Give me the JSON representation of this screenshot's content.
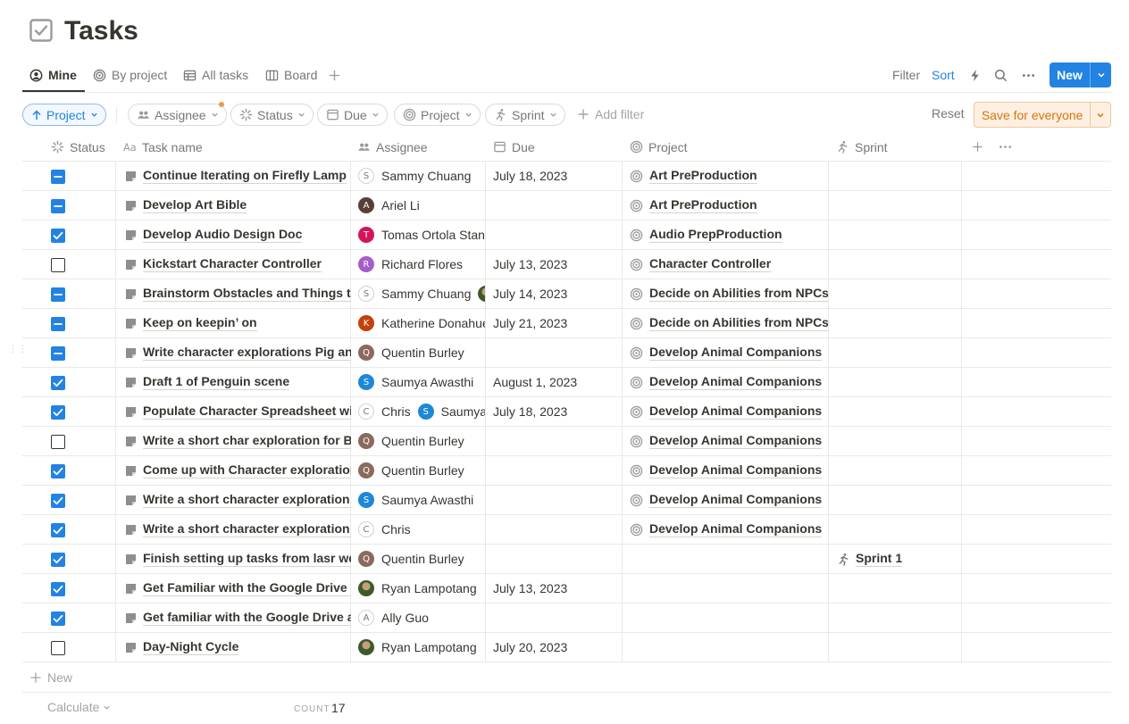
{
  "page": {
    "title": "Tasks"
  },
  "tabs": [
    {
      "label": "Mine",
      "icon": "user-circle-icon",
      "active": true
    },
    {
      "label": "By project",
      "icon": "target-icon"
    },
    {
      "label": "All tasks",
      "icon": "table-icon"
    },
    {
      "label": "Board",
      "icon": "board-icon"
    }
  ],
  "toolbar": {
    "filter": "Filter",
    "sort": "Sort",
    "new": "New"
  },
  "filters": {
    "sort_chip": "Project",
    "chips": [
      "Assignee",
      "Status",
      "Due",
      "Project",
      "Sprint"
    ],
    "add_filter": "Add filter",
    "reset": "Reset",
    "save": "Save for everyone"
  },
  "columns": {
    "status": "Status",
    "name": "Task name",
    "assignee": "Assignee",
    "due": "Due",
    "project": "Project",
    "sprint": "Sprint"
  },
  "rows": [
    {
      "status": "partial",
      "name": "Continue Iterating on Firefly Lamp",
      "assignees": [
        {
          "initial": "S",
          "name": "Sammy Chuang",
          "color": "light"
        }
      ],
      "due": "July 18, 2023",
      "project": "Art PreProduction",
      "sprint": ""
    },
    {
      "status": "partial",
      "name": "Develop Art Bible",
      "assignees": [
        {
          "initial": "A",
          "name": "Ariel Li",
          "color": "#5a3e36"
        }
      ],
      "due": "",
      "project": "Art PreProduction",
      "sprint": ""
    },
    {
      "status": "checked",
      "name": "Develop Audio Design Doc",
      "assignees": [
        {
          "initial": "T",
          "name": "Tomas Ortola Stanganelli",
          "color": "#d4145a"
        }
      ],
      "due": "",
      "project": "Audio PrepProduction",
      "sprint": ""
    },
    {
      "status": "empty",
      "name": "Kickstart Character Controller",
      "assignees": [
        {
          "initial": "R",
          "name": "Richard Flores",
          "color": "#a55ec8"
        }
      ],
      "due": "July 13, 2023",
      "project": "Character Controller",
      "sprint": ""
    },
    {
      "status": "partial",
      "name": "Brainstorm Obstacles and Things that",
      "assignees": [
        {
          "initial": "S",
          "name": "Sammy Chuang",
          "color": "light"
        },
        {
          "initial": "",
          "name": "",
          "color": "photo"
        }
      ],
      "due": "July 14, 2023",
      "project": "Decide on Abilities from NPCs",
      "sprint": ""
    },
    {
      "status": "partial",
      "name": "Keep on keepin’ on",
      "assignees": [
        {
          "initial": "K",
          "name": "Katherine Donahue",
          "color": "#c2410c"
        }
      ],
      "due": "July 21, 2023",
      "project": "Decide on Abilities from NPCs",
      "sprint": ""
    },
    {
      "status": "partial",
      "name": "Write character explorations Pig and",
      "assignees": [
        {
          "initial": "Q",
          "name": "Quentin Burley",
          "color": "#8a6a5c"
        }
      ],
      "due": "",
      "project": "Develop Animal Companions",
      "sprint": ""
    },
    {
      "status": "checked",
      "name": "Draft 1 of Penguin scene",
      "assignees": [
        {
          "initial": "S",
          "name": "Saumya Awasthi",
          "color": "#1e88d8"
        }
      ],
      "due": "August 1, 2023",
      "project": "Develop Animal Companions",
      "sprint": ""
    },
    {
      "status": "checked",
      "name": "Populate Character Spreadsheet with",
      "assignees": [
        {
          "initial": "C",
          "name": "Chris",
          "color": "light"
        },
        {
          "initial": "S",
          "name": "Saumya",
          "color": "#1e88d8"
        }
      ],
      "due": "July 18, 2023",
      "project": "Develop Animal Companions",
      "sprint": ""
    },
    {
      "status": "empty",
      "name": "Write a short char exploration for Ba",
      "assignees": [
        {
          "initial": "Q",
          "name": "Quentin Burley",
          "color": "#8a6a5c"
        }
      ],
      "due": "",
      "project": "Develop Animal Companions",
      "sprint": ""
    },
    {
      "status": "checked",
      "name": "Come up with Character exploration",
      "assignees": [
        {
          "initial": "Q",
          "name": "Quentin Burley",
          "color": "#8a6a5c"
        }
      ],
      "due": "",
      "project": "Develop Animal Companions",
      "sprint": ""
    },
    {
      "status": "checked",
      "name": "Write a short character exploration c",
      "assignees": [
        {
          "initial": "S",
          "name": "Saumya Awasthi",
          "color": "#1e88d8"
        }
      ],
      "due": "",
      "project": "Develop Animal Companions",
      "sprint": ""
    },
    {
      "status": "checked",
      "name": "Write a short character exploration c",
      "assignees": [
        {
          "initial": "C",
          "name": "Chris",
          "color": "light"
        }
      ],
      "due": "",
      "project": "Develop Animal Companions",
      "sprint": ""
    },
    {
      "status": "checked",
      "name": "Finish setting up tasks from lasr wee",
      "assignees": [
        {
          "initial": "Q",
          "name": "Quentin Burley",
          "color": "#8a6a5c"
        }
      ],
      "due": "",
      "project": "",
      "sprint": "Sprint 1"
    },
    {
      "status": "checked",
      "name": "Get Familiar with the Google Drive a",
      "assignees": [
        {
          "initial": "",
          "name": "Ryan Lampotang",
          "color": "photo"
        }
      ],
      "due": "July 13, 2023",
      "project": "",
      "sprint": ""
    },
    {
      "status": "checked",
      "name": "Get familiar with the Google Drive ar",
      "assignees": [
        {
          "initial": "A",
          "name": "Ally Guo",
          "color": "light"
        }
      ],
      "due": "",
      "project": "",
      "sprint": ""
    },
    {
      "status": "empty",
      "name": "Day-Night Cycle",
      "assignees": [
        {
          "initial": "",
          "name": "Ryan Lampotang",
          "color": "photo"
        }
      ],
      "due": "July 20, 2023",
      "project": "",
      "sprint": ""
    }
  ],
  "footer": {
    "new": "New",
    "calculate": "Calculate",
    "count_label": "COUNT",
    "count_value": "17"
  },
  "colors": {
    "accent": "#2383e2",
    "save_orange": "#d9730d",
    "text": "#37352f",
    "muted": "#787774"
  }
}
